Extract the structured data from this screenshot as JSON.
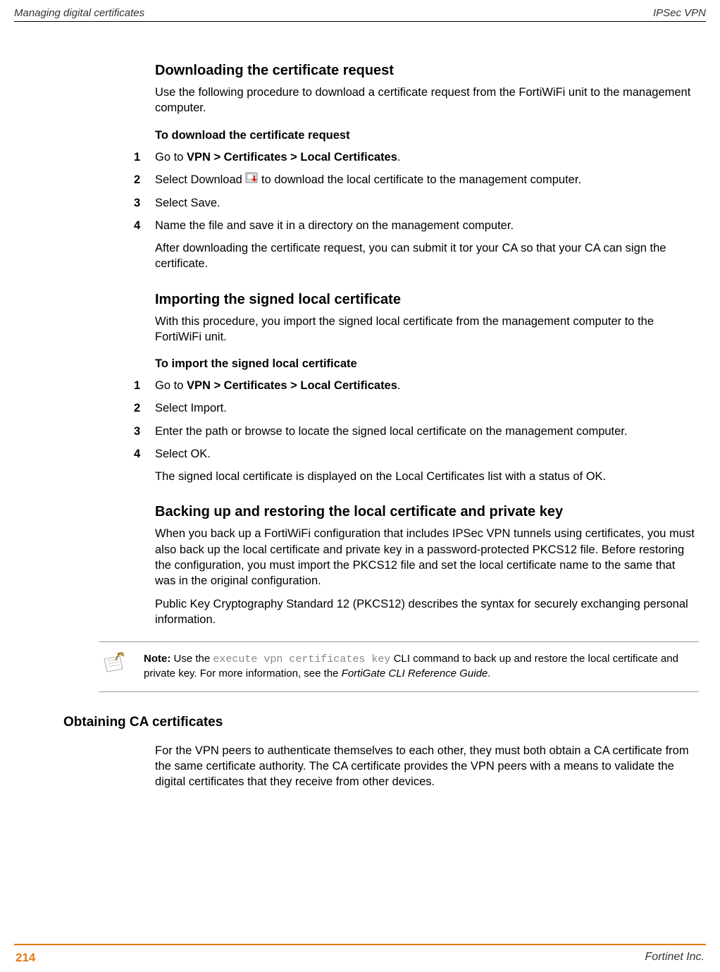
{
  "header": {
    "left": "Managing digital certificates",
    "right": "IPSec VPN"
  },
  "s1": {
    "heading": "Downloading the certificate request",
    "intro": "Use the following procedure to download a certificate request from the FortiWiFi unit to the management computer.",
    "subheading": "To download the certificate request",
    "steps": {
      "n1": "1",
      "t1_before": "Go to ",
      "t1_bold": "VPN > Certificates > Local Certificates",
      "t1_after": ".",
      "n2": "2",
      "t2_before": "Select Download ",
      "t2_after": " to download the local certificate to the management computer.",
      "n3": "3",
      "t3": "Select Save.",
      "n4": "4",
      "t4": "Name the file and save it in a directory on the management computer."
    },
    "post": "After downloading the certificate request, you can submit it tor your CA so that your CA can sign the certificate."
  },
  "s2": {
    "heading": "Importing the signed local certificate",
    "intro": "With this procedure, you import the signed local certificate from the management computer to the FortiWiFi unit.",
    "subheading": "To import the signed local certificate",
    "steps": {
      "n1": "1",
      "t1_before": "Go to ",
      "t1_bold": "VPN > Certificates > Local Certificates",
      "t1_after": ".",
      "n2": "2",
      "t2": "Select Import.",
      "n3": "3",
      "t3": "Enter the path or browse to locate the signed local certificate on the management computer.",
      "n4": "4",
      "t4": "Select OK."
    },
    "post": "The signed local certificate is displayed on the Local Certificates list with a status of OK."
  },
  "s3": {
    "heading": "Backing up and restoring the local certificate and private key",
    "p1": "When you back up a FortiWiFi configuration that includes IPSec VPN tunnels using certificates, you must also back up the local certificate and private key in a password-protected PKCS12 file. Before restoring the configuration, you must import the PKCS12 file and set the local certificate name to the same that was in the original configuration.",
    "p2": "Public Key Cryptography Standard 12 (PKCS12) describes the syntax for securely exchanging personal information."
  },
  "note": {
    "label": "Note:",
    "t1": " Use the ",
    "code": "execute vpn certificates key",
    "t2": " CLI command to back up and restore the local certificate and private key. For more information, see the ",
    "ref": "FortiGate CLI Reference Guide",
    "t3": "."
  },
  "s4": {
    "heading": "Obtaining CA certificates",
    "p1": "For the VPN peers to authenticate themselves to each other, they must both obtain a CA certificate from the same certificate authority. The CA certificate provides the VPN peers with a means to validate the digital certificates that they receive from other devices."
  },
  "footer": {
    "page": "214",
    "right": "Fortinet Inc."
  }
}
